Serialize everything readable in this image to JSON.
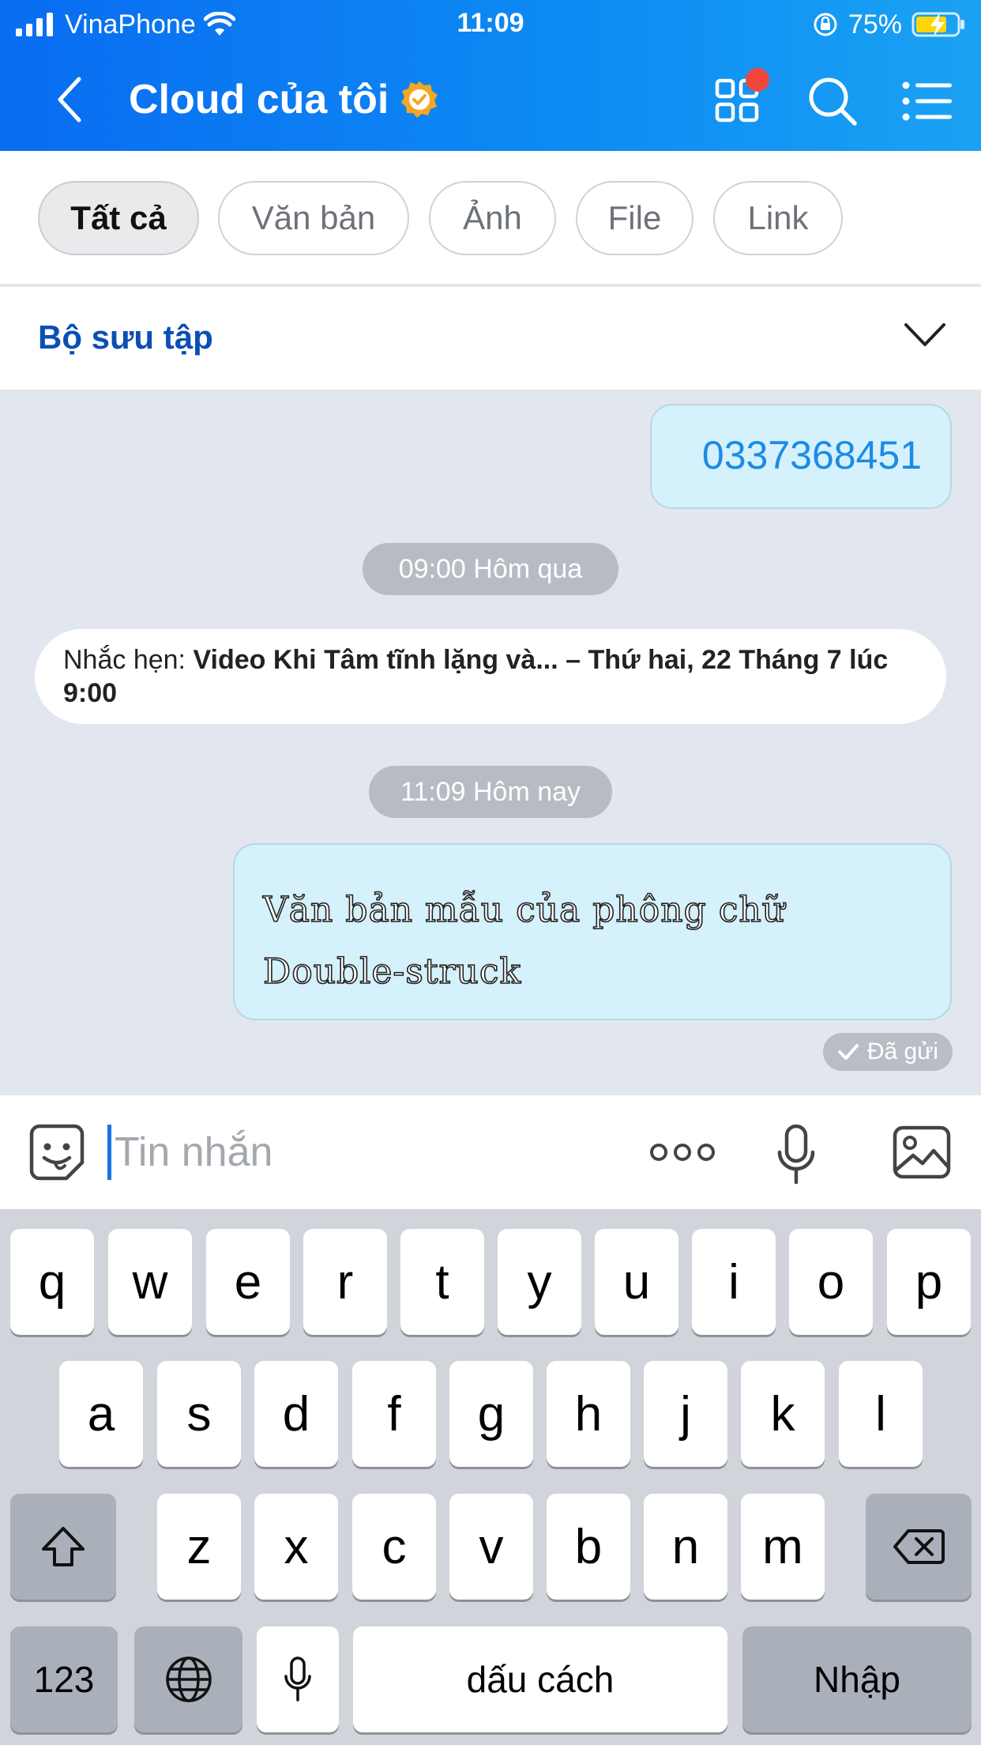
{
  "status_bar": {
    "carrier": "VinaPhone",
    "time": "11:09",
    "battery": "75%"
  },
  "header": {
    "title": "Cloud của tôi",
    "icons": [
      "back-icon",
      "verified-badge-icon",
      "grid-icon",
      "search-icon",
      "menu-list-icon"
    ]
  },
  "filters": [
    {
      "label": "Tất cả",
      "active": true
    },
    {
      "label": "Văn bản",
      "active": false
    },
    {
      "label": "Ảnh",
      "active": false
    },
    {
      "label": "File",
      "active": false
    },
    {
      "label": "Link",
      "active": false
    }
  ],
  "collection": {
    "label": "Bộ sưu tập"
  },
  "chat": {
    "phone_message": "0337368451",
    "time_yesterday": "09:00 Hôm qua",
    "reminder": {
      "prefix": "Nhắc hẹn: ",
      "text": "Video Khi Tâm tĩnh lặng và... – Thứ hai, 22 Tháng 7 lúc 9:00"
    },
    "time_today": "11:09 Hôm nay",
    "text_message": "Văn bản mẫu của phông chữ Double-struck",
    "sent_status": "Đã gửi"
  },
  "composer": {
    "placeholder": "Tin nhắn"
  },
  "keyboard": {
    "row1": [
      "q",
      "w",
      "e",
      "r",
      "t",
      "y",
      "u",
      "i",
      "o",
      "p"
    ],
    "row2": [
      "a",
      "s",
      "d",
      "f",
      "g",
      "h",
      "j",
      "k",
      "l"
    ],
    "row3": [
      "z",
      "x",
      "c",
      "v",
      "b",
      "n",
      "m"
    ],
    "numbers_label": "123",
    "space_label": "dấu cách",
    "return_label": "Nhập"
  },
  "colors": {
    "header_blue": "#0d8cf3",
    "bubble_bg": "#d4f1fc",
    "link_blue": "#1b8be6",
    "collection_blue": "#0a4fb3",
    "badge_red": "#f0463e",
    "verified_orange": "#f5a623"
  }
}
